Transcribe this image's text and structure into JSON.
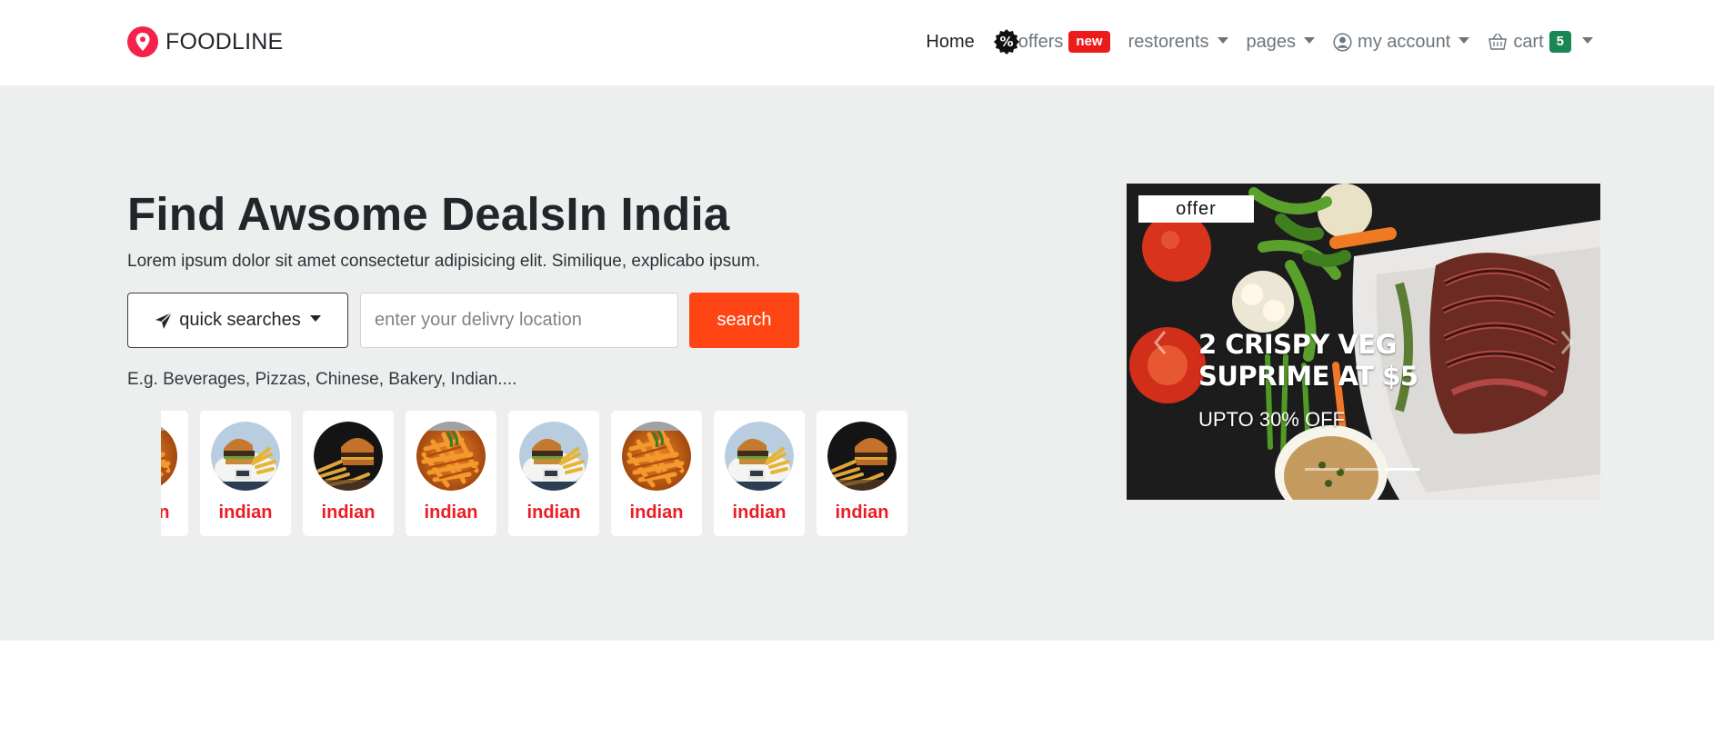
{
  "brand": {
    "name": "FOODLINE",
    "icon": "map-pin-icon",
    "color": "#f5234c"
  },
  "nav": {
    "home": "Home",
    "offers": "offers",
    "offers_badge": "new",
    "restorents": "restorents",
    "pages": "pages",
    "account": "my account",
    "cart": "cart",
    "cart_count": "5"
  },
  "hero": {
    "title": "Find Awsome DealsIn India",
    "subtitle": "Lorem ipsum dolor sit amet consectetur adipisicing elit. Similique, explicabo ipsum.",
    "quick_searches": "quick searches",
    "location_placeholder": "enter your delivry location",
    "search_button": "search",
    "examples": "E.g. Beverages, Pizzas, Chinese, Bakery, Indian...."
  },
  "categories": [
    {
      "label": "indian",
      "image": "pasta"
    },
    {
      "label": "indian",
      "image": "burger-plate"
    },
    {
      "label": "indian",
      "image": "burger-dark"
    },
    {
      "label": "indian",
      "image": "pasta"
    },
    {
      "label": "indian",
      "image": "burger-plate"
    },
    {
      "label": "indian",
      "image": "pasta"
    },
    {
      "label": "indian",
      "image": "burger-plate"
    },
    {
      "label": "indian",
      "image": "burger-dark"
    }
  ],
  "carousel": {
    "tag": "offer",
    "title": "2 CRISPY VEG SUPRIME AT $5",
    "subtitle": "UPTO 30% OFF",
    "active_slide": 3,
    "slide_count": 3
  },
  "colors": {
    "accent": "#ff4513",
    "hero_bg": "#edeeee",
    "category_label": "#ec1c24",
    "badge_new": "#ec1c1c",
    "badge_cart": "#198754"
  }
}
